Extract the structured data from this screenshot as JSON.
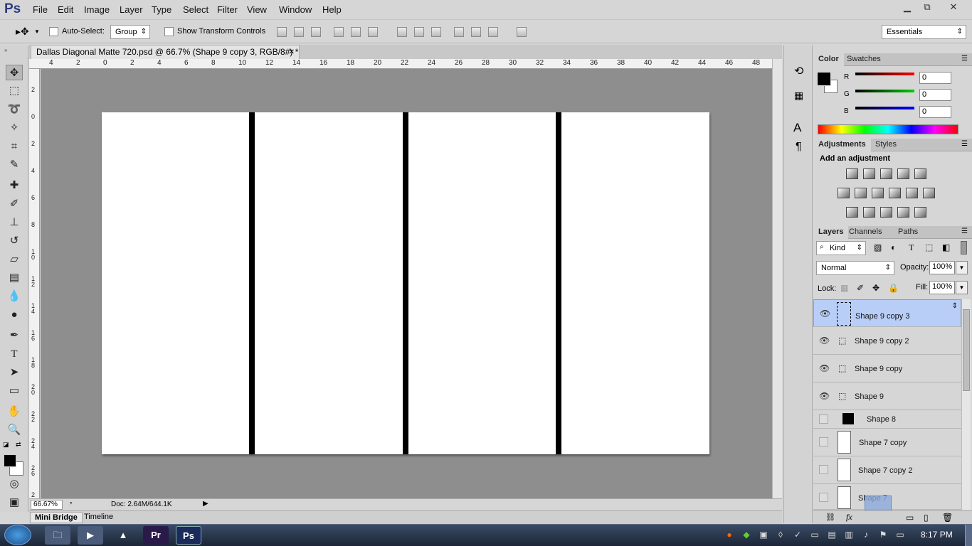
{
  "app": {
    "logo": "Ps"
  },
  "menu": [
    "File",
    "Edit",
    "Image",
    "Layer",
    "Type",
    "Select",
    "Filter",
    "View",
    "Window",
    "Help"
  ],
  "window_controls": {
    "minimize": "▁",
    "restore": "⧉",
    "close": "✕"
  },
  "options_bar": {
    "auto_select_label": "Auto-Select:",
    "auto_select_value": "Group",
    "transform_label": "Show Transform Controls",
    "workspace": "Essentials"
  },
  "document": {
    "tab_title": "Dallas Diagonal Matte 720.psd @ 66.7% (Shape 9 copy 3, RGB/8#) *",
    "close": "✕",
    "ruler_h": [
      "4",
      "2",
      "0",
      "2",
      "4",
      "6",
      "8",
      "10",
      "12",
      "14",
      "16",
      "18",
      "20",
      "22",
      "24",
      "26",
      "28",
      "30",
      "32",
      "34",
      "36",
      "38",
      "40",
      "42",
      "44",
      "46",
      "48"
    ],
    "ruler_v": [
      "2",
      "0",
      "2",
      "4",
      "6",
      "8",
      "1 0",
      "1 2",
      "1 4",
      "1 6",
      "1 8",
      "2 0",
      "2 2",
      "2 4",
      "2 6",
      "2"
    ]
  },
  "status": {
    "zoom": "66.67%",
    "doc": "Doc: 2.64M/644.1K"
  },
  "bottom_tabs": [
    "Mini Bridge",
    "Timeline"
  ],
  "color_panel": {
    "tabs": [
      "Color",
      "Swatches"
    ],
    "channels": [
      {
        "label": "R",
        "value": "0",
        "color": "#e02020"
      },
      {
        "label": "G",
        "value": "0",
        "color": "#20b020"
      },
      {
        "label": "B",
        "value": "0",
        "color": "#2020e0"
      }
    ]
  },
  "adjustments_panel": {
    "tabs": [
      "Adjustments",
      "Styles"
    ],
    "heading": "Add an adjustment"
  },
  "layers_panel": {
    "tabs": [
      "Layers",
      "Channels",
      "Paths"
    ],
    "filter": "Kind",
    "blend_mode": "Normal",
    "opacity_label": "Opacity:",
    "opacity": "100%",
    "lock_label": "Lock:",
    "fill_label": "Fill:",
    "fill": "100%",
    "layers": [
      {
        "name": "Shape 9 copy 3",
        "visible": true,
        "selected": true
      },
      {
        "name": "Shape 9 copy 2",
        "visible": true,
        "selected": false
      },
      {
        "name": "Shape 9 copy",
        "visible": true,
        "selected": false
      },
      {
        "name": "Shape 9",
        "visible": true,
        "selected": false
      },
      {
        "name": "Shape 8",
        "visible": false,
        "selected": false
      },
      {
        "name": "Shape 7 copy",
        "visible": false,
        "selected": false
      },
      {
        "name": "Shape 7 copy 2",
        "visible": false,
        "selected": false
      },
      {
        "name": "Shape 7",
        "visible": false,
        "selected": false
      }
    ]
  },
  "taskbar": {
    "time": "8:17 PM"
  }
}
